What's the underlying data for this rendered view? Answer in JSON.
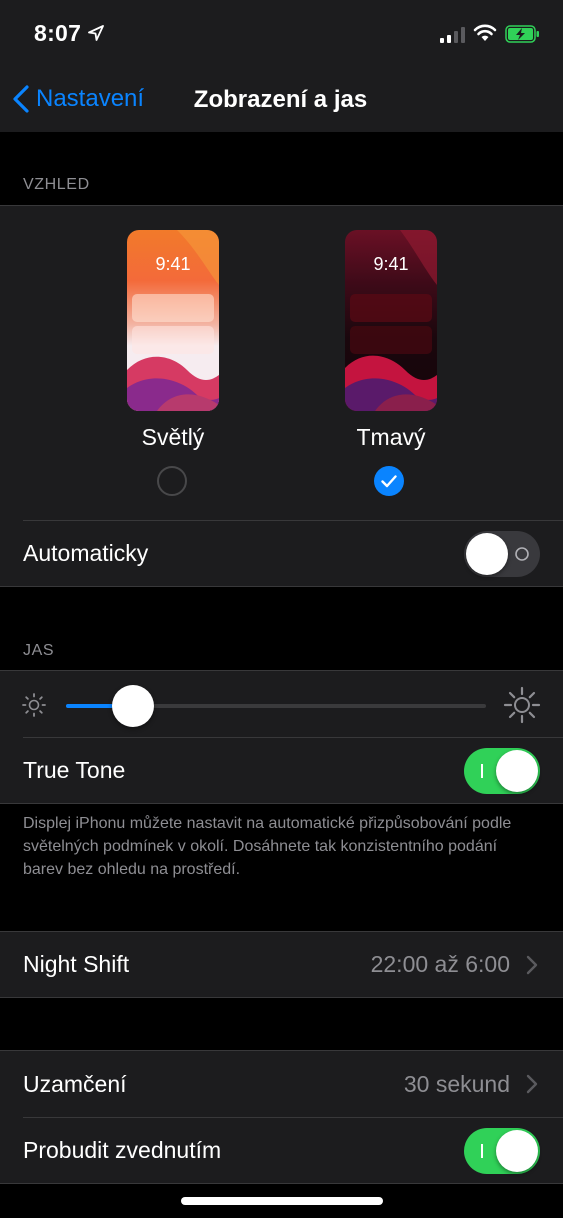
{
  "status_bar": {
    "time": "8:07",
    "icons": [
      "location-arrow-icon",
      "signal-icon",
      "wifi-icon",
      "battery-charging-icon"
    ]
  },
  "nav": {
    "back_label": "Nastavení",
    "title": "Zobrazení a jas"
  },
  "appearance": {
    "header": "VZHLED",
    "options": [
      {
        "label": "Světlý",
        "preview_time": "9:41",
        "selected": false
      },
      {
        "label": "Tmavý",
        "preview_time": "9:41",
        "selected": true
      }
    ],
    "automatic": {
      "label": "Automaticky",
      "on": false
    }
  },
  "brightness": {
    "header": "JAS",
    "level_percent": 13,
    "true_tone": {
      "label": "True Tone",
      "on": true
    },
    "footnote": "Displej iPhonu můžete nastavit na automatické přizpůsobování podle světelných podmínek v okolí. Dosáhnete tak konzistentního podání barev bez ohledu na prostředí."
  },
  "night_shift": {
    "label": "Night Shift",
    "value": "22:00 až 6:00"
  },
  "lock": {
    "auto_lock": {
      "label": "Uzamčení",
      "value": "30 sekund"
    },
    "raise_to_wake": {
      "label": "Probudit zvednutím",
      "on": true
    }
  },
  "colors": {
    "accent": "#0a84ff",
    "toggle_on": "#30d158",
    "toggle_off": "#39393d",
    "cell_background": "#1c1c1e",
    "page_background": "#000000",
    "secondary_text": "#8e8e93"
  }
}
